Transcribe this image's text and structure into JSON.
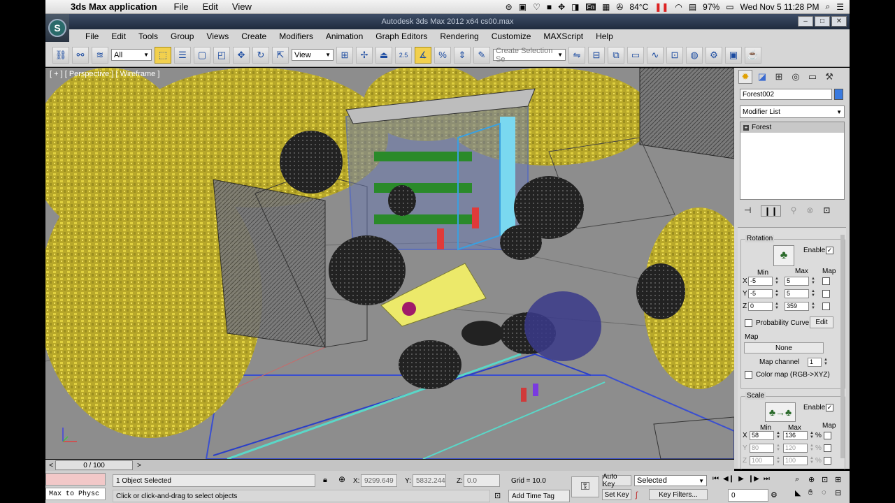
{
  "mac_menubar": {
    "app_name": "3ds Max application",
    "menus": [
      "File",
      "Edit",
      "View"
    ],
    "temperature": "84°C",
    "battery": "97%",
    "datetime": "Wed Nov 5  11:28 PM"
  },
  "window": {
    "title": "Autodesk 3ds Max  2012 x64      cs00.max",
    "logo_text": "S"
  },
  "menubar": [
    "File",
    "Edit",
    "Tools",
    "Group",
    "Views",
    "Create",
    "Modifiers",
    "Animation",
    "Graph Editors",
    "Rendering",
    "Customize",
    "MAXScript",
    "Help"
  ],
  "toolbar": {
    "filter_value": "All",
    "ref_coord_value": "View",
    "snap_angle_label": "2.5",
    "selection_set_placeholder": "Create Selection Se"
  },
  "viewport": {
    "label": "[ + ] [ Perspective ] [ Wireframe ]"
  },
  "command_panel": {
    "object_name": "Forest002",
    "modifier_list_value": "Modifier List",
    "stack_item": "Forest",
    "rotation": {
      "title": "Rotation",
      "enable_label": "Enable",
      "min_label": "Min",
      "max_label": "Max",
      "map_label": "Map",
      "rows": [
        {
          "axis": "X",
          "min": "-5",
          "max": "5"
        },
        {
          "axis": "Y",
          "min": "-5",
          "max": "5"
        },
        {
          "axis": "Z",
          "min": "0",
          "max": "359"
        }
      ],
      "probability_curve_label": "Probability Curve",
      "edit_label": "Edit",
      "map_section_label": "Map",
      "map_button_label": "None",
      "map_channel_label": "Map channel",
      "map_channel_value": "1",
      "color_map_label": "Color map (RGB->XYZ)"
    },
    "scale": {
      "title": "Scale",
      "enable_label": "Enable",
      "min_label": "Min",
      "max_label": "Max",
      "map_label": "Map",
      "percent": "%",
      "rows": [
        {
          "axis": "X",
          "min": "58",
          "max": "136"
        },
        {
          "axis": "Y",
          "min": "80",
          "max": "120"
        },
        {
          "axis": "Z",
          "min": "100",
          "max": "100"
        }
      ]
    }
  },
  "timeline": {
    "slider_label": "0 / 100",
    "prev": "<",
    "next": ">"
  },
  "status": {
    "maxscript_text": "Max to Physc",
    "selected_text": "1 Object Selected",
    "prompt_text": "Click or click-and-drag to select objects",
    "x_label": "X:",
    "x_value": "9299.649",
    "y_label": "Y:",
    "y_value": "5832.244",
    "z_label": "Z:",
    "z_value": "0.0",
    "grid_text": "Grid = 10.0",
    "add_time_tag": "Add Time Tag",
    "auto_key": "Auto Key",
    "set_key": "Set Key",
    "key_mode_value": "Selected",
    "key_filters": "Key Filters...",
    "frame_value": "0"
  }
}
